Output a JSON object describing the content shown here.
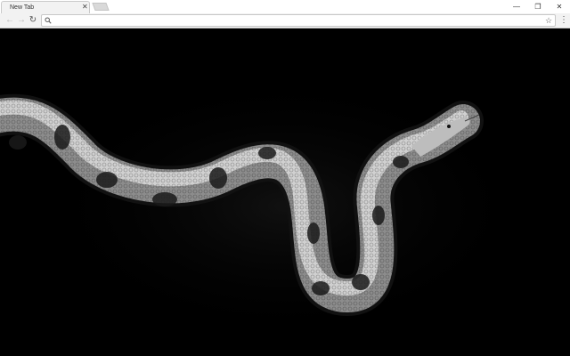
{
  "browser": {
    "tab": {
      "title": "New Tab",
      "close_glyph": "✕"
    },
    "window_controls": {
      "minimize": "—",
      "restore": "❐",
      "close": "✕"
    },
    "toolbar": {
      "back_glyph": "←",
      "forward_glyph": "→",
      "reload_glyph": "↻",
      "omnibox_value": "",
      "star_glyph": "☆",
      "menu_glyph": "⋮"
    }
  },
  "page": {
    "background_color": "#000000",
    "wallpaper": "snake-photo"
  },
  "colors": {
    "tabstrip": "#ffffff",
    "toolbar": "#f2f2f2",
    "disabled_icon": "#b5b5b5",
    "active_icon": "#555555"
  }
}
